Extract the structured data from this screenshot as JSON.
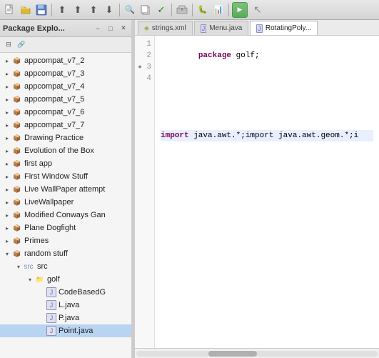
{
  "toolbar": {
    "icons": [
      {
        "name": "new-file-icon",
        "symbol": "📄"
      },
      {
        "name": "open-file-icon",
        "symbol": "📂"
      },
      {
        "name": "save-icon",
        "symbol": "💾"
      },
      {
        "name": "save-all-icon",
        "symbol": "💾"
      },
      {
        "name": "export-icon",
        "symbol": "⬆"
      },
      {
        "name": "import-icon",
        "symbol": "⬇"
      },
      {
        "name": "print-icon",
        "symbol": "🖨"
      },
      {
        "name": "run-icon",
        "symbol": "▶"
      }
    ],
    "run_label": "▶"
  },
  "package_explorer": {
    "title": "Package Explo...",
    "tree_items": [
      {
        "label": "appcompat_v7_2",
        "level": 1,
        "type": "package",
        "arrow": "closed"
      },
      {
        "label": "appcompat_v7_3",
        "level": 1,
        "type": "package",
        "arrow": "closed"
      },
      {
        "label": "appcompat_v7_4",
        "level": 1,
        "type": "package",
        "arrow": "closed"
      },
      {
        "label": "appcompat_v7_5",
        "level": 1,
        "type": "package",
        "arrow": "closed"
      },
      {
        "label": "appcompat_v7_6",
        "level": 1,
        "type": "package",
        "arrow": "closed"
      },
      {
        "label": "appcompat_v7_7",
        "level": 1,
        "type": "package",
        "arrow": "closed"
      },
      {
        "label": "Drawing Practice",
        "level": 1,
        "type": "package",
        "arrow": "closed"
      },
      {
        "label": "Evolution of the Box",
        "level": 1,
        "type": "package",
        "arrow": "closed"
      },
      {
        "label": "first app",
        "level": 1,
        "type": "package",
        "arrow": "closed"
      },
      {
        "label": "First Window Stuff",
        "level": 1,
        "type": "package",
        "arrow": "closed"
      },
      {
        "label": "Live WallPaper attempt",
        "level": 1,
        "type": "package",
        "arrow": "closed"
      },
      {
        "label": "LiveWallpaper",
        "level": 1,
        "type": "package",
        "arrow": "closed"
      },
      {
        "label": "Modified Conways Gan",
        "level": 1,
        "type": "package",
        "arrow": "closed"
      },
      {
        "label": "Plane Dogfight",
        "level": 1,
        "type": "package",
        "arrow": "closed"
      },
      {
        "label": "Primes",
        "level": 1,
        "type": "package",
        "arrow": "closed"
      },
      {
        "label": "random stuff",
        "level": 1,
        "type": "package",
        "arrow": "open"
      },
      {
        "label": "src",
        "level": 2,
        "type": "src",
        "arrow": "open"
      },
      {
        "label": "golf",
        "level": 3,
        "type": "folder",
        "arrow": "open"
      },
      {
        "label": "CodeBasedG",
        "level": 4,
        "type": "java",
        "arrow": "leaf"
      },
      {
        "label": "L.java",
        "level": 4,
        "type": "java",
        "arrow": "leaf"
      },
      {
        "label": "P.java",
        "level": 4,
        "type": "java",
        "arrow": "leaf"
      },
      {
        "label": "Point.java",
        "level": 4,
        "type": "java",
        "arrow": "leaf",
        "selected": true
      }
    ]
  },
  "editor": {
    "tabs": [
      {
        "label": "strings.xml",
        "type": "xml",
        "active": false
      },
      {
        "label": "Menu.java",
        "type": "java",
        "active": false
      },
      {
        "label": "RotatingPoly...",
        "type": "java",
        "active": true
      }
    ],
    "lines": [
      {
        "num": 1,
        "content": "package golf;",
        "highlight": false
      },
      {
        "num": 2,
        "content": "",
        "highlight": false
      },
      {
        "num": 3,
        "content": "import java.awt.*;import java.awt.geom.*;i",
        "highlight": true
      },
      {
        "num": 4,
        "content": "",
        "highlight": false
      }
    ]
  }
}
